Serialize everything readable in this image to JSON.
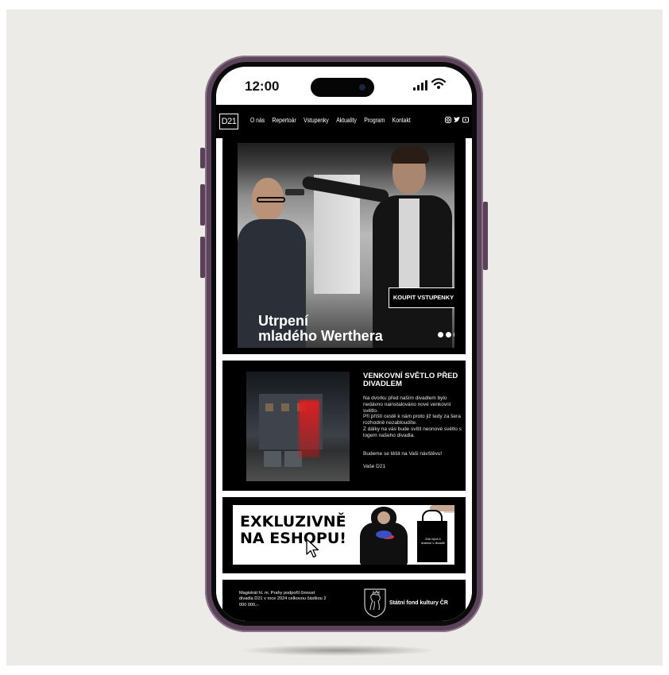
{
  "status_bar": {
    "time": "12:00",
    "signal_icon": "cellular-signal-icon",
    "wifi_icon": "wifi-icon"
  },
  "nav": {
    "logo": "D21",
    "items": [
      {
        "label": "O nás"
      },
      {
        "label": "Repertoár"
      },
      {
        "label": "Vstupenky"
      },
      {
        "label": "Aktuality"
      },
      {
        "label": "Program"
      },
      {
        "label": "Kontakt"
      }
    ],
    "social": [
      "instagram-icon",
      "twitter-icon",
      "youtube-icon"
    ]
  },
  "hero": {
    "button_label": "KOUPIT VSTUPENKY",
    "title_line1": "Utrpení",
    "title_line2": "mladého Werthera",
    "dots": 3
  },
  "news": {
    "title": "VENKOVNÍ SVĚTLO PŘED DIVADLEM",
    "body_lines": [
      "Na dvorku před naším divadlem bylo nedávno nainstalováno nové venkovní světlo.",
      "Při příští cestě k nám proto již tedy za šera rozhodně nezabloudíte.",
      "Z dálky na vás bude svítit neonové světlo s logem našeho divadla."
    ],
    "greeting": "Budeme se těšit na Vaši návštěvu!",
    "signature": "Vaše D21"
  },
  "eshop": {
    "line1": "EXKLUZIVNĚ",
    "line2": "NA ESHOPU!",
    "bag_text": "Zde bývá k dostání v divadle"
  },
  "footer": {
    "text": "Magistrát hl. m. Prahy podpořil činnost divadla D21 v roce 2024 celkovou částkou 2 000 000,-.",
    "fund_label": "Státní fond kultury ČR",
    "emblem_icon": "czech-lion-emblem-icon"
  }
}
